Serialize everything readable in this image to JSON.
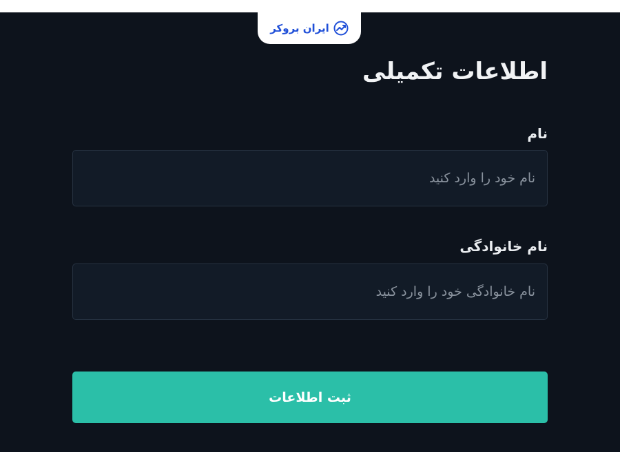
{
  "brand": {
    "logo_text": "ایران بروکر",
    "logo_icon": "trend-chart-icon",
    "logo_color": "#1f4fd8"
  },
  "form": {
    "title": "اطلاعات تکمیلی",
    "first_name": {
      "label": "نام",
      "placeholder": "نام خود را وارد کنید",
      "value": ""
    },
    "last_name": {
      "label": "نام خانوادگی",
      "placeholder": "نام خانوادگی خود را وارد کنید",
      "value": ""
    },
    "submit_label": "ثبت اطلاعات"
  },
  "colors": {
    "background": "#0d131c",
    "input_background": "#121b27",
    "input_border": "#263241",
    "accent": "#2bbfa8",
    "text": "#f1f3f5",
    "placeholder": "#8a939e"
  }
}
